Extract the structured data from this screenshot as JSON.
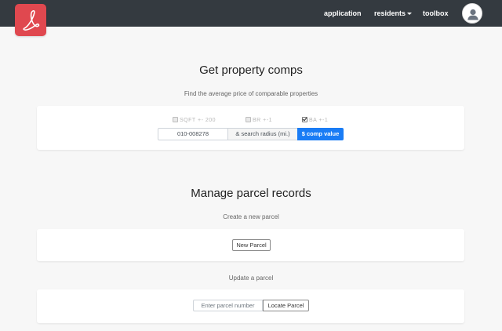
{
  "navbar": {
    "logo_icon": "scribble-logo-icon",
    "links": {
      "application": "application",
      "residents": "residents",
      "toolbox": "toolbox"
    },
    "avatar_icon": "user-avatar-icon"
  },
  "comps": {
    "title": "Get property comps",
    "subtitle": "Find the average price of comparable properties",
    "checkboxes": {
      "sqft": {
        "label": "SQFT +- 200",
        "checked": false
      },
      "br": {
        "label": "BR +-1",
        "checked": false
      },
      "ba": {
        "label": "BA +-1",
        "checked": true
      }
    },
    "parcel_value": "010-008278",
    "radius_placeholder": "& search radius (mi.)",
    "submit_label": "$ comp value"
  },
  "parcels": {
    "title": "Manage parcel records",
    "create_subtitle": "Create a new parcel",
    "new_button": "New Parcel",
    "update_subtitle": "Update a parcel",
    "parcel_placeholder": "Enter parcel number",
    "locate_button": "Locate Parcel"
  },
  "colors": {
    "navbar": "#343a40",
    "logo": "#e0484f",
    "primary": "#1a7cf5",
    "background": "#f7f7f7"
  }
}
